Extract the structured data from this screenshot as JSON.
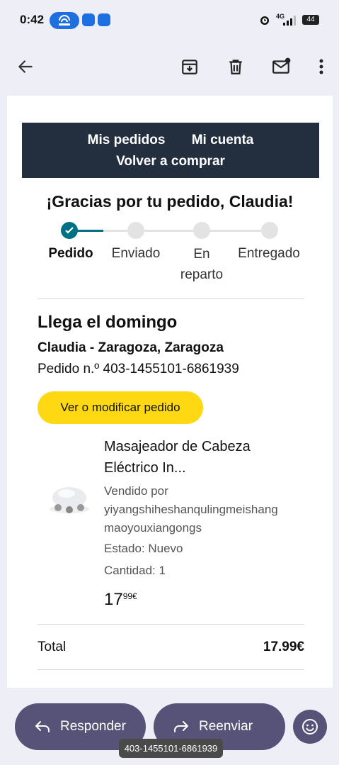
{
  "status_bar": {
    "time": "0:42",
    "network": "4G",
    "battery": "44"
  },
  "toolbar": {
    "back_icon": "arrow-left-icon",
    "archive_icon": "archive-icon",
    "delete_icon": "trash-icon",
    "mark_unread_icon": "mail-dot-icon",
    "more_icon": "more-vert-icon"
  },
  "email": {
    "nav": {
      "orders": "Mis pedidos",
      "account": "Mi cuenta",
      "buy_again": "Volver a comprar"
    },
    "thanks": "¡Gracias por tu pedido, Claudia!",
    "tracker": {
      "steps": [
        "Pedido",
        "Enviado",
        "En reparto",
        "Entregado"
      ],
      "current_step": 1,
      "accent": "#007185"
    },
    "arrival": "Llega el domingo",
    "address": "Claudia - Zaragoza, Zaragoza",
    "order_number": "Pedido n.º 403-1455101-6861939",
    "modify_button": "Ver o modificar pedido",
    "product": {
      "name_line1": "Masajeador de Cabeza",
      "name_line2": "Eléctrico In...",
      "sold_by_label": "Vendido por",
      "seller_line1": "yiyangshiheshanqulingmeishang",
      "seller_line2": "maoyouxiangongs",
      "condition": "Estado: Nuevo",
      "quantity": "Cantidad: 1",
      "price_whole": "17",
      "price_fraction": "99€"
    },
    "total_label": "Total",
    "total_value": "17.99€"
  },
  "actions": {
    "reply": "Responder",
    "forward": "Reenviar",
    "emoji_icon": "smiley-icon"
  },
  "toast": "403-1455101-6861939",
  "colors": {
    "nav_bg": "#232f3e",
    "button_yellow": "#ffd814",
    "fab_bg": "#565278"
  }
}
